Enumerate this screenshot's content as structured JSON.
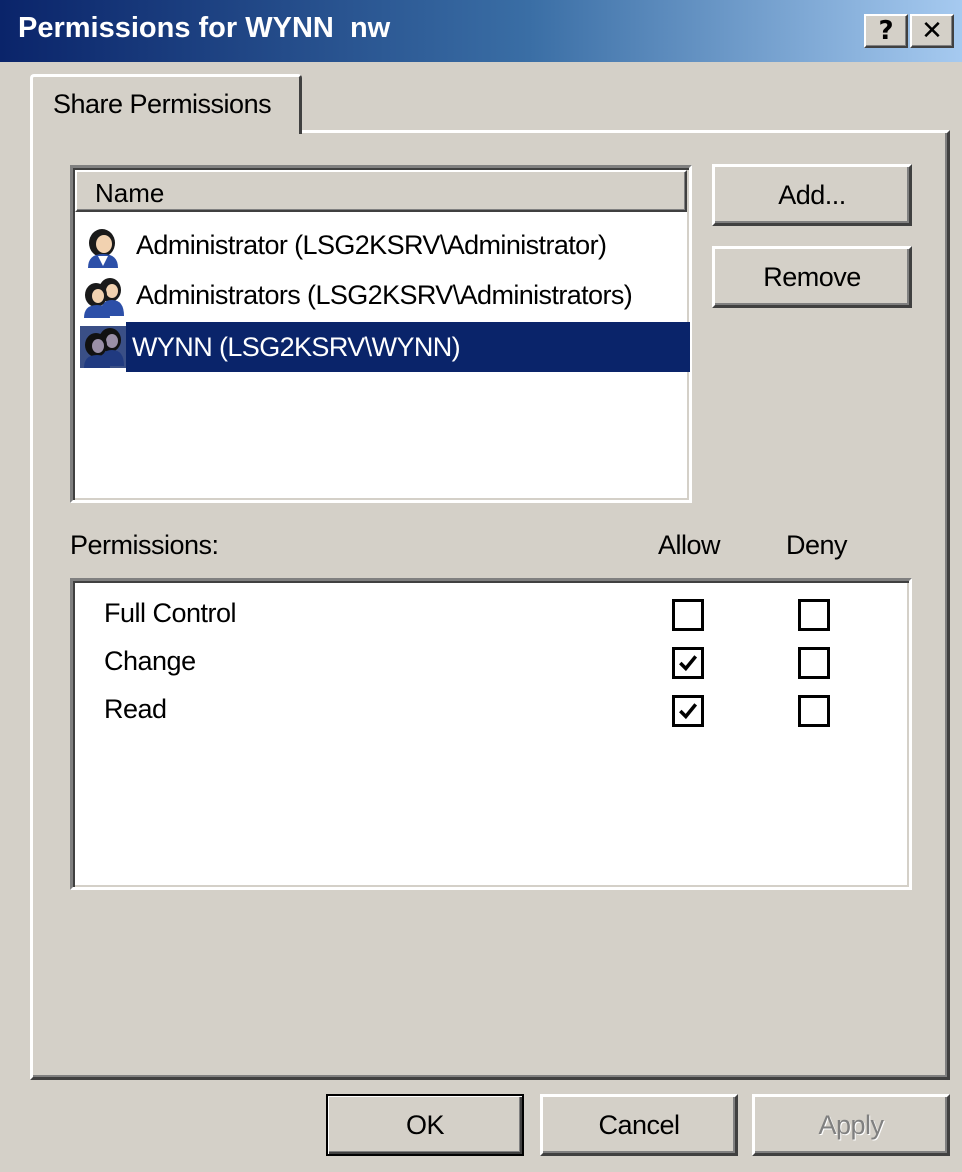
{
  "window": {
    "title": "Permissions for WYNN  nw",
    "help_glyph": "?",
    "close_glyph": "✕"
  },
  "tabs": [
    {
      "label": "Share Permissions",
      "active": true
    }
  ],
  "names_list": {
    "header": "Name",
    "items": [
      {
        "label": "Administrator (LSG2KSRV\\Administrator)",
        "icon": "user-icon",
        "selected": false
      },
      {
        "label": "Administrators (LSG2KSRV\\Administrators)",
        "icon": "group-icon",
        "selected": false
      },
      {
        "label": "WYNN (LSG2KSRV\\WYNN)",
        "icon": "group-icon",
        "selected": true
      }
    ]
  },
  "buttons": {
    "add": "Add...",
    "remove": "Remove",
    "ok": "OK",
    "cancel": "Cancel",
    "apply": "Apply"
  },
  "permissions": {
    "label": "Permissions:",
    "allow_header": "Allow",
    "deny_header": "Deny",
    "rows": [
      {
        "name": "Full Control",
        "allow": false,
        "deny": false
      },
      {
        "name": "Change",
        "allow": true,
        "deny": false
      },
      {
        "name": "Read",
        "allow": true,
        "deny": false
      }
    ]
  },
  "colors": {
    "selection": "#0a246a",
    "title_gradient_start": "#0a246a",
    "title_gradient_end": "#a6caf0",
    "face": "#d4d0c8"
  }
}
